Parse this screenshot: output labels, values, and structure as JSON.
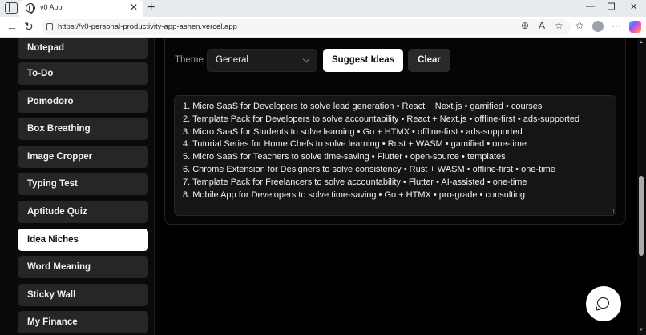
{
  "browser": {
    "tab_title": "v0 App",
    "url": "https://v0-personal-productivity-app-ashen.vercel.app",
    "tab_close": "✕",
    "new_tab": "+",
    "minimize": "—",
    "restore": "❐",
    "close": "✕",
    "back": "←",
    "refresh": "↻",
    "zoom_icon": "⊕",
    "read_aloud_icon": "A",
    "favorite_icon": "☆",
    "collections_icon": "✩",
    "more_icon": "···"
  },
  "sidebar": {
    "items": [
      {
        "label": "Notepad"
      },
      {
        "label": "To-Do"
      },
      {
        "label": "Pomodoro"
      },
      {
        "label": "Box Breathing"
      },
      {
        "label": "Image Cropper"
      },
      {
        "label": "Typing Test"
      },
      {
        "label": "Aptitude Quiz"
      },
      {
        "label": "Idea Niches",
        "active": true
      },
      {
        "label": "Word Meaning"
      },
      {
        "label": "Sticky Wall"
      },
      {
        "label": "My Finance"
      }
    ]
  },
  "controls": {
    "theme_label": "Theme",
    "theme_value": "General",
    "suggest_label": "Suggest Ideas",
    "clear_label": "Clear"
  },
  "ideas": [
    "1. Micro SaaS for Developers to solve lead generation • React + Next.js • gamified • courses",
    "2. Template Pack for Developers to solve accountability • React + Next.js • offline-first • ads-supported",
    "3. Micro SaaS for Students to solve learning • Go + HTMX • offline-first • ads-supported",
    "4. Tutorial Series for Home Chefs to solve learning • Rust + WASM • gamified • one-time",
    "5. Micro SaaS for Teachers to solve time-saving • Flutter • open-source • templates",
    "6. Chrome Extension for Designers to solve consistency • Rust + WASM • offline-first • one-time",
    "7. Template Pack for Freelancers to solve accountability • Flutter • AI-assisted • one-time",
    "8. Mobile App for Developers to solve time-saving • Go + HTMX • pro-grade • consulting"
  ],
  "colors": {
    "background": "#000000",
    "nav_item": "#262626",
    "nav_active": "#ffffff",
    "accent_button": "#ffffff"
  }
}
